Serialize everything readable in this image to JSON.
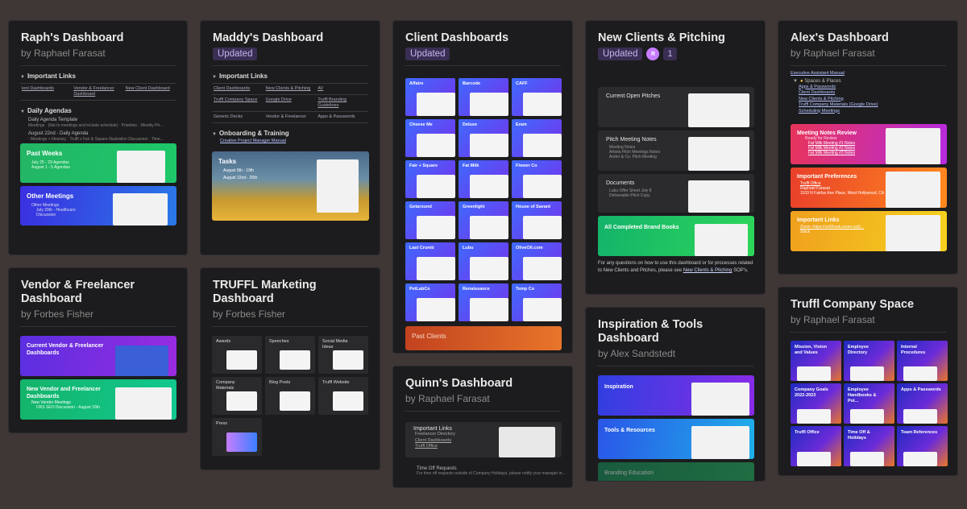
{
  "cards": {
    "raph": {
      "title": "Raph's Dashboard",
      "by": "by Raphael Farasat",
      "important_links": "Important Links",
      "links": [
        "lent Dashboards",
        "Vendor & Freelancer Dashboard",
        "New Client Dashboard"
      ],
      "daily": "Daily Agendas",
      "template": "Daily Agenda Template",
      "template_sub": "Meetings · (link to meetings and include schedule) · Priorities · Weekly Pri...",
      "aug": "August 22nd - Daily Agenda",
      "aug_sub": "· Meetings + Itinerary · Truffl x Fair & Square Illustration Discussion · Time...",
      "past": "Past Weeks",
      "past1": "July 25 - 29 Agendas",
      "past2": "August 1 - 5 Agendas",
      "other": "Other Meetings",
      "other1": "Other Meetings",
      "other2": "July 29th - Healthcare Discussion"
    },
    "maddy": {
      "title": "Maddy's Dashboard",
      "badge": "Updated",
      "important_links": "Important Links",
      "rows": [
        [
          "Client Dashboards",
          "New Clients & Pitching",
          "AV"
        ],
        [
          "Truffl Company Space",
          "Google Drive",
          "Truffl Branding Guidelines"
        ],
        [
          "Generic Decks",
          "Vendor & Freelancer",
          "Apps & Passwords"
        ]
      ],
      "onboarding": "Onboarding & Training",
      "manual": "Creative Project Manager Manual",
      "tasks": "Tasks",
      "task1": "August 8th - 19th",
      "task2": "August 22nd - 26th"
    },
    "client": {
      "title": "Client Dashboards",
      "badge": "Updated",
      "tiles": [
        "Affaire",
        "Barcode",
        "CAFF",
        "Cheese Me",
        "Deluxe",
        "Eram",
        "Fair + Square",
        "Fat Milk",
        "Flower Co",
        "Getaround",
        "Greenlight",
        "House of Savant",
        "Last Crumb",
        "Lubu",
        "OliveOil.com",
        "PetLabCo",
        "Renaissance",
        "Temp Co"
      ],
      "past": "Past Clients"
    },
    "quinn": {
      "title": "Quinn's Dashboard",
      "by": "by Raphael Farasat",
      "important_links": "Important Links",
      "links": [
        "Freelancer Directory",
        "Client Dashboards",
        "Truffl Office"
      ],
      "timeoff": "Time Off Requests",
      "timeoff_sub": "For time off requests outside of Company Holidays, please notify your manager in..."
    },
    "newclients": {
      "title": "New Clients & Pitching",
      "badge": "Updated",
      "avatar": "R",
      "count": "1",
      "rows": [
        {
          "t": "Current Open Pitches",
          "s": []
        },
        {
          "t": "Pitch Meeting Notes",
          "s": [
            "Meeting Notes",
            "Arbela Pitch Meetings Notes",
            "Andor & Co. Pitch Meeting"
          ]
        },
        {
          "t": "Documents",
          "s": [
            "Lubu Offer Sheet July 8",
            "Deliverable Pitch Copy"
          ]
        }
      ],
      "brand": "All Completed Brand Books",
      "footer_pre": "For any questions on how to use this dashboard or for processes related to New Clients and Pitches, please see ",
      "footer_link": "New Clients & Pitching",
      "footer_post": " SOP's."
    },
    "inspiration": {
      "title": "Inspiration & Tools Dashboard",
      "by": "by Alex Sandstedt",
      "b1": "Inspiration",
      "b2": "Tools & Resources",
      "b3": "Branding Education"
    },
    "alex": {
      "title": "Alex's Dashboard",
      "by": "by Raphael Farasat",
      "manual": "Executive Assistant Manual",
      "spaces": "Spaces & Places",
      "links": [
        "Apps & Passwords",
        "Client Dashboards",
        "New Clients & Pitching",
        "Truffl Company Materials (Google Drive)",
        "Scheduling Meetings"
      ],
      "b1": "Meeting Notes Review",
      "b1s": [
        "Ready for Review",
        "Fat Milk Meeting #1 Notes",
        "Fat Milk Meeting #2 Notes",
        "Fat Milk Meeting #3 Notes"
      ],
      "b2": "Important Preferences",
      "b2s": [
        "Truffl Office",
        "Raphael Farasat",
        "1163 N Fairfax Ave Place, West Hollywood, CA"
      ],
      "b3": "Important Links",
      "b3s": [
        "Zoom: https://us02web.zoom.us/j/...",
        "Slack"
      ]
    },
    "vendor": {
      "title": "Vendor & Freelancer Dashboard",
      "by": "by Forbes Fisher",
      "b1": "Current Vendor & Freelancer Dashboards",
      "b2": "New Vendor and Freelancer Dashboards",
      "b2s": [
        "New Vendor Meetings",
        "DRS SEO Discussion - August 16th"
      ]
    },
    "marketing": {
      "title": "TRUFFL Marketing Dashboard",
      "by": "by Forbes Fisher",
      "tiles": [
        "Awards",
        "Speeches",
        "Social Media Ideas",
        "Company Materials",
        "Blog Posts",
        "Truffl Website",
        "Press"
      ]
    },
    "company": {
      "title": "Truffl Company Space",
      "by": "by Raphael Farasat",
      "tiles": [
        "Mission, Vision and Values",
        "Employee Directory",
        "Internal Procedures",
        "Company Goals 2022-2023",
        "Employee Handbooks & Pol...",
        "Apps & Passwords",
        "Truffl Office",
        "Time Off & Holidays",
        "Team References"
      ]
    }
  },
  "colors": {
    "bg": "#3f3636",
    "card": "#1c1c1e",
    "badge": "#3a2e52",
    "accent": "#c4b4f2"
  }
}
